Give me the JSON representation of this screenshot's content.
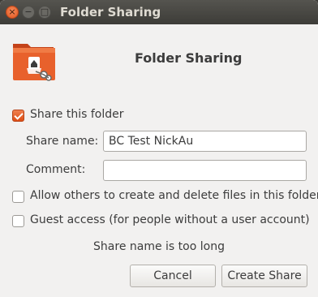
{
  "window": {
    "title": "Folder Sharing",
    "close_glyph": "×",
    "min_glyph": "−",
    "max_glyph": "□"
  },
  "header": {
    "title": "Folder Sharing",
    "icon": "shared-folder-icon"
  },
  "share_folder": {
    "label": "Share this folder",
    "checked": true
  },
  "share_name": {
    "label": "Share name:",
    "value": "BC Test NickAu"
  },
  "comment": {
    "label": "Comment:",
    "value": ""
  },
  "allow_others": {
    "label": "Allow others to create and delete files in this folder",
    "checked": false
  },
  "guest_access": {
    "label": "Guest access (for people without a user account)",
    "checked": false
  },
  "status": {
    "message": "Share name is too long"
  },
  "buttons": {
    "cancel": "Cancel",
    "create": "Create Share"
  },
  "colors": {
    "accent": "#dd4814",
    "titlebar": "#3d3c38",
    "background": "#f2f1f0"
  }
}
